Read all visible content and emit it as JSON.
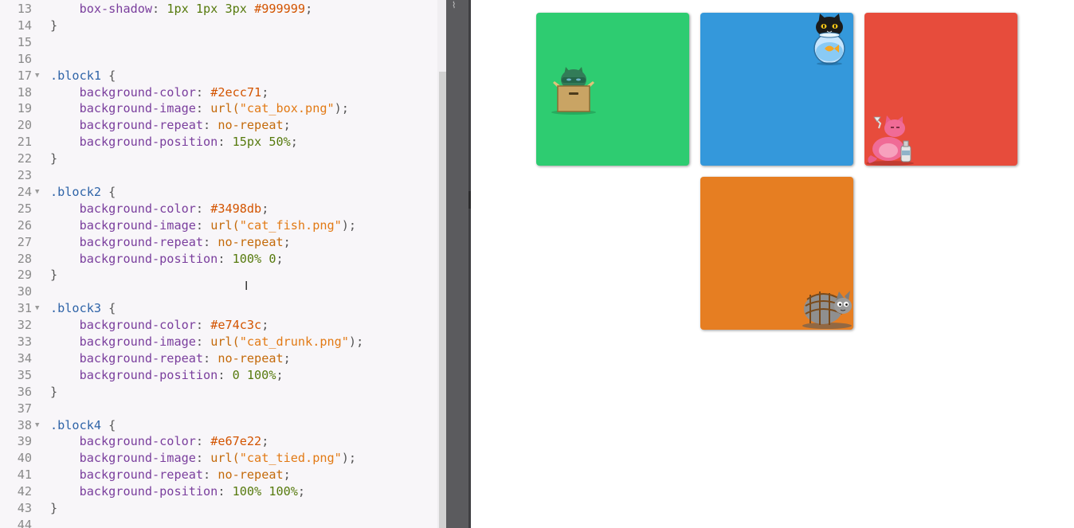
{
  "editor": {
    "lines": [
      {
        "n": "13",
        "fold": false,
        "tokens": [
          {
            "t": "    ",
            "c": ""
          },
          {
            "t": "box-shadow",
            "c": "t-prop"
          },
          {
            "t": ": ",
            "c": "t-punc"
          },
          {
            "t": "1px 1px 3px",
            "c": "t-num"
          },
          {
            "t": " ",
            "c": ""
          },
          {
            "t": "#999999",
            "c": "t-hex"
          },
          {
            "t": ";",
            "c": "t-punc"
          }
        ]
      },
      {
        "n": "14",
        "fold": false,
        "tokens": [
          {
            "t": "}",
            "c": "t-punc"
          }
        ]
      },
      {
        "n": "15",
        "fold": false,
        "tokens": []
      },
      {
        "n": "16",
        "fold": false,
        "tokens": []
      },
      {
        "n": "17",
        "fold": true,
        "tokens": [
          {
            "t": ".block1",
            "c": "t-sel"
          },
          {
            "t": " {",
            "c": "t-punc"
          }
        ]
      },
      {
        "n": "18",
        "fold": false,
        "tokens": [
          {
            "t": "    ",
            "c": ""
          },
          {
            "t": "background-color",
            "c": "t-prop"
          },
          {
            "t": ": ",
            "c": "t-punc"
          },
          {
            "t": "#2ecc71",
            "c": "t-hex"
          },
          {
            "t": ";",
            "c": "t-punc"
          }
        ]
      },
      {
        "n": "19",
        "fold": false,
        "tokens": [
          {
            "t": "    ",
            "c": ""
          },
          {
            "t": "background-image",
            "c": "t-prop"
          },
          {
            "t": ": ",
            "c": "t-punc"
          },
          {
            "t": "url(",
            "c": "t-kw"
          },
          {
            "t": "\"cat_box.png\"",
            "c": "t-str"
          },
          {
            "t": ");",
            "c": "t-punc"
          }
        ]
      },
      {
        "n": "20",
        "fold": false,
        "tokens": [
          {
            "t": "    ",
            "c": ""
          },
          {
            "t": "background-repeat",
            "c": "t-prop"
          },
          {
            "t": ": ",
            "c": "t-punc"
          },
          {
            "t": "no-repeat",
            "c": "t-kw"
          },
          {
            "t": ";",
            "c": "t-punc"
          }
        ]
      },
      {
        "n": "21",
        "fold": false,
        "tokens": [
          {
            "t": "    ",
            "c": ""
          },
          {
            "t": "background-position",
            "c": "t-prop"
          },
          {
            "t": ": ",
            "c": "t-punc"
          },
          {
            "t": "15px 50%",
            "c": "t-num"
          },
          {
            "t": ";",
            "c": "t-punc"
          }
        ]
      },
      {
        "n": "22",
        "fold": false,
        "tokens": [
          {
            "t": "}",
            "c": "t-punc"
          }
        ]
      },
      {
        "n": "23",
        "fold": false,
        "tokens": []
      },
      {
        "n": "24",
        "fold": true,
        "tokens": [
          {
            "t": ".block2",
            "c": "t-sel"
          },
          {
            "t": " {",
            "c": "t-punc"
          }
        ]
      },
      {
        "n": "25",
        "fold": false,
        "tokens": [
          {
            "t": "    ",
            "c": ""
          },
          {
            "t": "background-color",
            "c": "t-prop"
          },
          {
            "t": ": ",
            "c": "t-punc"
          },
          {
            "t": "#3498db",
            "c": "t-hex"
          },
          {
            "t": ";",
            "c": "t-punc"
          }
        ]
      },
      {
        "n": "26",
        "fold": false,
        "tokens": [
          {
            "t": "    ",
            "c": ""
          },
          {
            "t": "background-image",
            "c": "t-prop"
          },
          {
            "t": ": ",
            "c": "t-punc"
          },
          {
            "t": "url(",
            "c": "t-kw"
          },
          {
            "t": "\"cat_fish.png\"",
            "c": "t-str"
          },
          {
            "t": ");",
            "c": "t-punc"
          }
        ]
      },
      {
        "n": "27",
        "fold": false,
        "tokens": [
          {
            "t": "    ",
            "c": ""
          },
          {
            "t": "background-repeat",
            "c": "t-prop"
          },
          {
            "t": ": ",
            "c": "t-punc"
          },
          {
            "t": "no-repeat",
            "c": "t-kw"
          },
          {
            "t": ";",
            "c": "t-punc"
          }
        ]
      },
      {
        "n": "28",
        "fold": false,
        "tokens": [
          {
            "t": "    ",
            "c": ""
          },
          {
            "t": "background-position",
            "c": "t-prop"
          },
          {
            "t": ": ",
            "c": "t-punc"
          },
          {
            "t": "100% 0",
            "c": "t-num"
          },
          {
            "t": ";",
            "c": "t-punc"
          }
        ]
      },
      {
        "n": "29",
        "fold": false,
        "tokens": [
          {
            "t": "}",
            "c": "t-punc"
          }
        ]
      },
      {
        "n": "30",
        "fold": false,
        "tokens": []
      },
      {
        "n": "31",
        "fold": true,
        "tokens": [
          {
            "t": ".block3",
            "c": "t-sel"
          },
          {
            "t": " {",
            "c": "t-punc"
          }
        ]
      },
      {
        "n": "32",
        "fold": false,
        "tokens": [
          {
            "t": "    ",
            "c": ""
          },
          {
            "t": "background-color",
            "c": "t-prop"
          },
          {
            "t": ": ",
            "c": "t-punc"
          },
          {
            "t": "#e74c3c",
            "c": "t-hex"
          },
          {
            "t": ";",
            "c": "t-punc"
          }
        ]
      },
      {
        "n": "33",
        "fold": false,
        "tokens": [
          {
            "t": "    ",
            "c": ""
          },
          {
            "t": "background-image",
            "c": "t-prop"
          },
          {
            "t": ": ",
            "c": "t-punc"
          },
          {
            "t": "url(",
            "c": "t-kw"
          },
          {
            "t": "\"cat_drunk.png\"",
            "c": "t-str"
          },
          {
            "t": ");",
            "c": "t-punc"
          }
        ]
      },
      {
        "n": "34",
        "fold": false,
        "tokens": [
          {
            "t": "    ",
            "c": ""
          },
          {
            "t": "background-repeat",
            "c": "t-prop"
          },
          {
            "t": ": ",
            "c": "t-punc"
          },
          {
            "t": "no-repeat",
            "c": "t-kw"
          },
          {
            "t": ";",
            "c": "t-punc"
          }
        ]
      },
      {
        "n": "35",
        "fold": false,
        "tokens": [
          {
            "t": "    ",
            "c": ""
          },
          {
            "t": "background-position",
            "c": "t-prop"
          },
          {
            "t": ": ",
            "c": "t-punc"
          },
          {
            "t": "0 100%",
            "c": "t-num"
          },
          {
            "t": ";",
            "c": "t-punc"
          }
        ]
      },
      {
        "n": "36",
        "fold": false,
        "tokens": [
          {
            "t": "}",
            "c": "t-punc"
          }
        ]
      },
      {
        "n": "37",
        "fold": false,
        "tokens": []
      },
      {
        "n": "38",
        "fold": true,
        "tokens": [
          {
            "t": ".block4",
            "c": "t-sel"
          },
          {
            "t": " {",
            "c": "t-punc"
          }
        ]
      },
      {
        "n": "39",
        "fold": false,
        "tokens": [
          {
            "t": "    ",
            "c": ""
          },
          {
            "t": "background-color",
            "c": "t-prop"
          },
          {
            "t": ": ",
            "c": "t-punc"
          },
          {
            "t": "#e67e22",
            "c": "t-hex"
          },
          {
            "t": ";",
            "c": "t-punc"
          }
        ]
      },
      {
        "n": "40",
        "fold": false,
        "tokens": [
          {
            "t": "    ",
            "c": ""
          },
          {
            "t": "background-image",
            "c": "t-prop"
          },
          {
            "t": ": ",
            "c": "t-punc"
          },
          {
            "t": "url(",
            "c": "t-kw"
          },
          {
            "t": "\"cat_tied.png\"",
            "c": "t-str"
          },
          {
            "t": ");",
            "c": "t-punc"
          }
        ]
      },
      {
        "n": "41",
        "fold": false,
        "tokens": [
          {
            "t": "    ",
            "c": ""
          },
          {
            "t": "background-repeat",
            "c": "t-prop"
          },
          {
            "t": ": ",
            "c": "t-punc"
          },
          {
            "t": "no-repeat",
            "c": "t-kw"
          },
          {
            "t": ";",
            "c": "t-punc"
          }
        ]
      },
      {
        "n": "42",
        "fold": false,
        "tokens": [
          {
            "t": "    ",
            "c": ""
          },
          {
            "t": "background-position",
            "c": "t-prop"
          },
          {
            "t": ": ",
            "c": "t-punc"
          },
          {
            "t": "100% 100%",
            "c": "t-num"
          },
          {
            "t": ";",
            "c": "t-punc"
          }
        ]
      },
      {
        "n": "43",
        "fold": false,
        "tokens": [
          {
            "t": "}",
            "c": "t-punc"
          }
        ]
      },
      {
        "n": "44",
        "fold": false,
        "tokens": []
      }
    ]
  },
  "preview": {
    "blocks": [
      {
        "name": "block1",
        "color": "#2ecc71",
        "icon": "cat-box-icon"
      },
      {
        "name": "block2",
        "color": "#3498db",
        "icon": "cat-fish-icon"
      },
      {
        "name": "block3",
        "color": "#e74c3c",
        "icon": "cat-drunk-icon"
      },
      {
        "name": "block4",
        "color": "#e67e22",
        "icon": "cat-tied-icon"
      }
    ]
  },
  "ui": {
    "text_cursor_glyph": "I",
    "splitter_handle_glyph": "⌇"
  }
}
